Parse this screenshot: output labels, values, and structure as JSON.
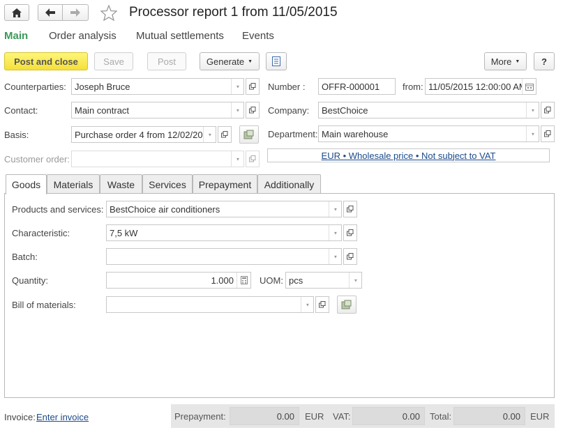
{
  "window": {
    "title": "Processor report 1 from 11/05/2015"
  },
  "nav": {
    "home_icon": "home-icon",
    "back_icon": "arrow-left-icon",
    "forward_icon": "arrow-right-icon",
    "favorite_icon": "star-icon"
  },
  "sections": [
    "Main",
    "Order analysis",
    "Mutual settlements",
    "Events"
  ],
  "toolbar": {
    "post_close": "Post and close",
    "save": "Save",
    "post": "Post",
    "generate": "Generate",
    "more": "More",
    "help": "?"
  },
  "header": {
    "counterparties_label": "Counterparties:",
    "counterparties_value": "Joseph Bruce",
    "contact_label": "Contact:",
    "contact_value": "Main contract",
    "basis_label": "Basis:",
    "basis_value": "Purchase order 4 from 12/02/20",
    "customer_order_label": "Customer order:",
    "customer_order_value": "",
    "number_label": "Number :",
    "number_value": "OFFR-000001",
    "from_label": "from:",
    "from_value": "11/05/2015 12:00:00 AM",
    "company_label": "Company:",
    "company_value": "BestChoice",
    "department_label": "Department:",
    "department_value": "Main warehouse",
    "price_link": "EUR • Wholesale price • Not subject to VAT"
  },
  "tabs": [
    "Goods",
    "Materials",
    "Waste",
    "Services",
    "Prepayment",
    "Additionally"
  ],
  "goods": {
    "products_label": "Products and services:",
    "products_value": "BestChoice air conditioners",
    "characteristic_label": "Characteristic:",
    "characteristic_value": "7,5 kW",
    "batch_label": "Batch:",
    "batch_value": "",
    "quantity_label": "Quantity:",
    "quantity_value": "1.000",
    "uom_label": "UOM:",
    "uom_value": "pcs",
    "bom_label": "Bill of materials:",
    "bom_value": ""
  },
  "footer": {
    "invoice_label": "Invoice:",
    "invoice_link": "Enter invoice",
    "prepayment_label": "Prepayment:",
    "prepayment_value": "0.00",
    "prepayment_currency": "EUR",
    "vat_label": "VAT:",
    "vat_value": "0.00",
    "total_label": "Total:",
    "total_value": "0.00",
    "total_currency": "EUR"
  },
  "colors": {
    "accent_green": "#3b9a5a",
    "primary_yellow": "#f5e03a",
    "link_blue": "#1c4a8a"
  }
}
